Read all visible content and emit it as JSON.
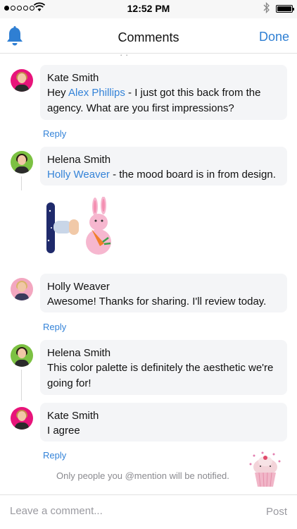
{
  "status_bar": {
    "time": "12:52 PM"
  },
  "nav": {
    "title": "Comments",
    "done_label": "Done"
  },
  "comments": [
    {
      "author": "Kate Smith",
      "mention": "Alex Phillips",
      "text": " - I just got this back from the agency. What are you first impressions?",
      "prefix": "Hey ",
      "reply_label": "Reply"
    },
    {
      "author": "Helena Smith",
      "mention": "Holly Weaver",
      "text": " - the mood board is in from design."
    },
    {
      "author": "Holly Weaver",
      "text": "Awesome! Thanks for sharing. I'll review today.",
      "reply_label": "Reply"
    },
    {
      "author": "Helena Smith",
      "text": "This color palette is definitely the aesthetic we're going for!"
    },
    {
      "author": "Kate Smith",
      "text": "I agree",
      "reply_label": "Reply"
    }
  ],
  "notice": "Only people you @mention will be notified.",
  "compose": {
    "placeholder": "Leave a comment...",
    "post_label": "Post"
  }
}
